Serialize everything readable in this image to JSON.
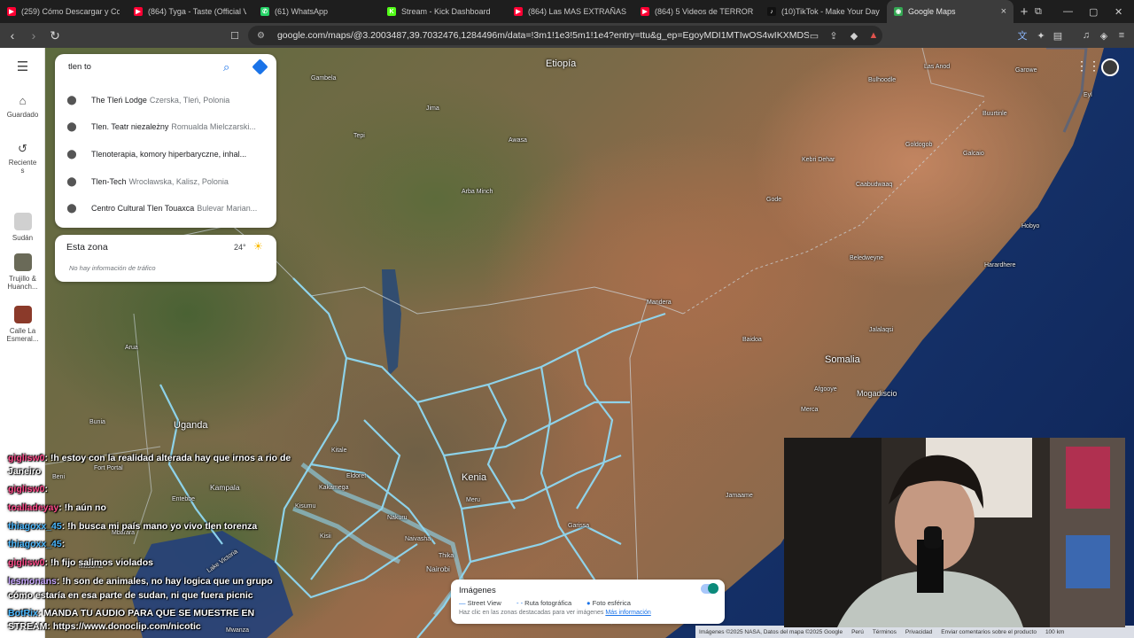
{
  "browser": {
    "tabs": [
      {
        "title": "(259) Cómo Descargar y Config",
        "color": "#ff0033",
        "glyph": "▶"
      },
      {
        "title": "(864) Tyga - Taste (Official Vid",
        "color": "#ff0033",
        "glyph": "▶"
      },
      {
        "title": "(61) WhatsApp",
        "color": "#25d366",
        "glyph": "✆"
      },
      {
        "title": "Stream - Kick Dashboard",
        "color": "#53fc18",
        "glyph": "K"
      },
      {
        "title": "(864) Las MAS EXTRAÑAS CIN",
        "color": "#ff0033",
        "glyph": "▶"
      },
      {
        "title": "(864) 5 Videos de TERROR EXT",
        "color": "#ff0033",
        "glyph": "▶"
      },
      {
        "title": "(10)TikTok - Make Your Day",
        "color": "#111111",
        "glyph": "♪"
      },
      {
        "title": "Google Maps",
        "color": "#34a853",
        "glyph": "◉"
      }
    ],
    "url": "google.com/maps/@3.2003487,39.7032476,1284496m/data=!3m1!1e3!5m1!1e4?entry=ttu&g_ep=EgoyMDI1MTIwOS4wIKXMDSoASAFQAw%3..."
  },
  "rail": {
    "menu_icon": "menu-icon",
    "saved_label": "Guardado",
    "recent_label": "Reciente\ns",
    "history": [
      {
        "label": "Sudán"
      },
      {
        "label": "Trujillo &\nHuanch..."
      },
      {
        "label": "Calle La\nEsmeral..."
      }
    ]
  },
  "search": {
    "value": "tlen to",
    "suggestions": [
      {
        "main": "The Tleń Lodge",
        "secondary": "Czerska, Tleń, Polonia"
      },
      {
        "main": "Tlen. Teatr niezależny",
        "secondary": "Romualda Mielczarski..."
      },
      {
        "main": "Tlenoterapia, komory hiperbaryczne, inhal...",
        "secondary": ""
      },
      {
        "main": "Tlen-Tech",
        "secondary": "Wrocławska, Kalisz, Polonia"
      },
      {
        "main": "Centro Cultural Tlen Touaxca",
        "secondary": "Bulevar Marian..."
      }
    ]
  },
  "zone": {
    "title": "Esta zona",
    "temp": "24°",
    "traffic": "No hay información de tráfico"
  },
  "map_labels": {
    "countries": [
      "Etiopía",
      "Somalia",
      "Uganda",
      "Kenia"
    ],
    "cities": [
      "Mogadiscio",
      "Kampala",
      "Nairobi"
    ],
    "places": [
      "Gambela",
      "Jima",
      "Tepi",
      "Awasa",
      "Arba Minch",
      "Bulhoodle",
      "Las Anod",
      "Garowe",
      "Eyl",
      "Buurtinle",
      "Goldogob",
      "Galcaio",
      "Kebri Dehar",
      "Caabudwaaq",
      "Gode",
      "Beledweyne",
      "Hobyo",
      "Harardhere",
      "Mandera",
      "Baidoa",
      "Jalalaqsi",
      "Afgooye",
      "Merca",
      "Arua",
      "Bunia",
      "Fort Portal",
      "Beni",
      "Entebbe",
      "Mbarara",
      "Kitale",
      "Eldoret",
      "Kakamega",
      "Kisumu",
      "Nakuru",
      "Meru",
      "Naivasha",
      "Kisii",
      "Thika",
      "Garissa",
      "Jamaame",
      "Mwanza",
      "Lake Victoria",
      "Musoma"
    ]
  },
  "chat": [
    {
      "user": "giglisw0",
      "text": "!h estoy con la realidad alterada hay que irnos a rio de",
      "tone": "user"
    },
    {
      "user": "",
      "text": "Janeiro",
      "tone": "user"
    },
    {
      "user": "giglisw0",
      "text": "",
      "tone": "user"
    },
    {
      "user": "toalladeyay",
      "text": "!h aún no",
      "tone": "user"
    },
    {
      "user": "thiagoxx_45",
      "text": "!h busca mi país mano yo vivo tlen torenza",
      "tone": "user2"
    },
    {
      "user": "thiagoxx_45",
      "text": "",
      "tone": "user2"
    },
    {
      "user": "giglisw0",
      "text": "!h fijo salimos violados",
      "tone": "user"
    },
    {
      "user": "lesmonans",
      "text": "!h son de animales, no hay logica que un grupo",
      "tone": "user3"
    },
    {
      "user": "",
      "text": "cómo estaría en esa parte de sudan, ni que fuera picnic",
      "tone": "user3"
    },
    {
      "user": "BotRix",
      "text": "MANDA TU AUDIO PARA QUE SE MUESTRE EN",
      "tone": "user2"
    },
    {
      "user": "",
      "text": "STREAM: https://www.donoclip.com/nicotic",
      "tone": "user2"
    }
  ],
  "imagery": {
    "title": "Imágenes",
    "street_view": "Street View",
    "photo_route": "Ruta fotográfica",
    "sphere": "Foto esférica",
    "hint": "Haz clic en las zonas destacadas para ver imágenes",
    "more": "Más información",
    "toggle_on": true
  },
  "footer": {
    "credits": "Imágenes ©2025 NASA, Datos del mapa ©2025 Google",
    "country": "Perú",
    "terms": "Términos",
    "privacy": "Privacidad",
    "feedback": "Enviar comentarios sobre el producto",
    "scale": "100 km"
  }
}
